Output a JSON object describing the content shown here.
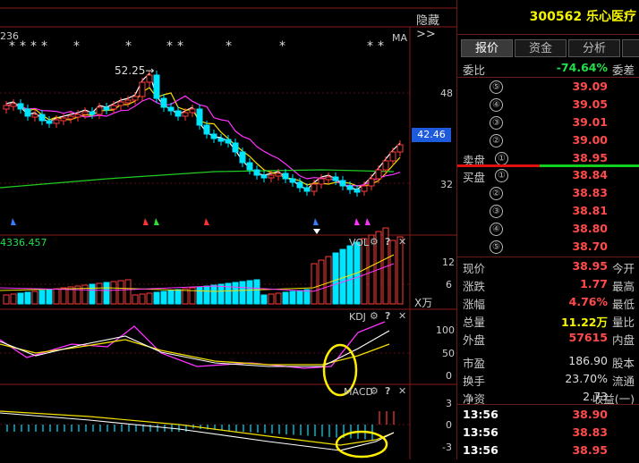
{
  "header": {
    "hide_label": "隐藏",
    "hide_chevron": ">>",
    "stock_code": "300562",
    "stock_name": "乐心医疗"
  },
  "main_panel": {
    "partial_label": "236",
    "indicator_label": "MA",
    "peak_label": "52.25",
    "y_ticks": [
      "48",
      "42.46",
      "32"
    ],
    "current_price_tag": "42.46",
    "stars": [
      "*",
      "*",
      "*",
      "*",
      "*",
      "*",
      "*",
      "*",
      "*",
      "*",
      "*",
      "*"
    ]
  },
  "vol_panel": {
    "value_label": "4336.457",
    "title": "VOL",
    "y_ticks": [
      "12",
      "6"
    ],
    "unit": "X万"
  },
  "kdj_panel": {
    "title": "KDJ",
    "y_ticks": [
      "100",
      "50",
      "0"
    ]
  },
  "macd_panel": {
    "title": "MACD",
    "y_ticks": [
      "3",
      "0",
      "-3"
    ]
  },
  "panel_icons": {
    "settings": "⚙",
    "help": "?",
    "close": "✕"
  },
  "tabs": [
    {
      "label": "报价",
      "active": true
    },
    {
      "label": "资金",
      "active": false
    },
    {
      "label": "分析",
      "active": false
    }
  ],
  "weibi": {
    "label": "委比",
    "value": "-74.64%",
    "label2": "委差"
  },
  "sell_orders": [
    {
      "level": "⑤",
      "price": "39.09"
    },
    {
      "level": "④",
      "price": "39.05"
    },
    {
      "level": "③",
      "price": "39.01"
    },
    {
      "level": "②",
      "price": "39.00"
    },
    {
      "level": "①",
      "price": "38.95",
      "side_label": "卖盘"
    }
  ],
  "buy_orders": [
    {
      "level": "①",
      "price": "38.84",
      "side_label": "买盘"
    },
    {
      "level": "②",
      "price": "38.83"
    },
    {
      "level": "③",
      "price": "38.81"
    },
    {
      "level": "④",
      "price": "38.80"
    },
    {
      "level": "⑤",
      "price": "38.70"
    }
  ],
  "quote_rows": [
    {
      "label": "现价",
      "value": "38.95",
      "right": "今开",
      "color": "red"
    },
    {
      "label": "涨跌",
      "value": "1.77",
      "right": "最高",
      "color": "red"
    },
    {
      "label": "涨幅",
      "value": "4.76%",
      "right": "最低",
      "color": "red"
    },
    {
      "label": "总量",
      "value": "11.22万",
      "right": "量比",
      "color": "yellow"
    },
    {
      "label": "外盘",
      "value": "57615",
      "right": "内盘",
      "color": "red"
    },
    {
      "label": "市盈",
      "value": "186.90",
      "right": "股本",
      "color": "plain"
    },
    {
      "label": "换手",
      "value": "23.70%",
      "right": "流通",
      "color": "plain"
    },
    {
      "label": "净资",
      "value": "2.73",
      "right": "收益(一)",
      "color": "plain"
    }
  ],
  "ticks": [
    {
      "time": "13:56",
      "price": "38.90"
    },
    {
      "time": "13:56",
      "price": "38.83"
    },
    {
      "time": "13:56",
      "price": "38.95"
    }
  ],
  "colors": {
    "up": "#ff3b3b",
    "down": "#00e5ff",
    "ma_white": "#ffffff",
    "ma_yellow": "#f5e000",
    "ma_magenta": "#ff33ff",
    "ma_green": "#22cc22",
    "annotation": "#ffee00"
  }
}
